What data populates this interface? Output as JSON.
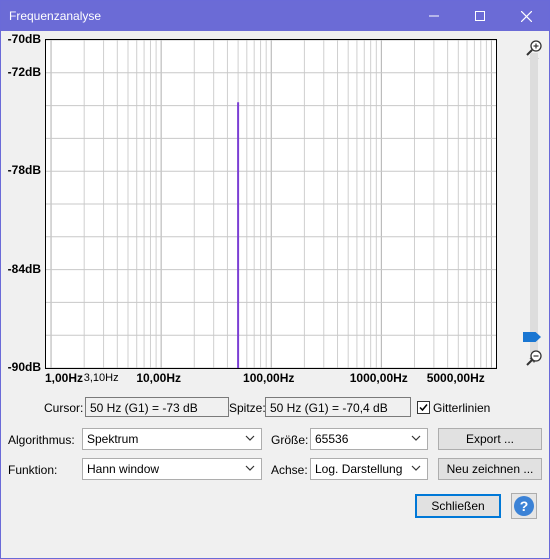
{
  "window": {
    "title": "Frequenzanalyse"
  },
  "chart_data": {
    "type": "line",
    "yticks": [
      "-70dB",
      "-72dB",
      "-78dB",
      "-84dB",
      "-90dB"
    ],
    "xticks": [
      "1,00Hz",
      "3,10Hz",
      "10,00Hz",
      "100,00Hz",
      "1000,00Hz",
      "5000,00Hz"
    ],
    "x_scale": "log",
    "ylim": [
      -90,
      -70
    ],
    "xlim": [
      0.9,
      11000
    ],
    "grid": true,
    "series": [
      {
        "x": [
          50,
          50
        ],
        "y": [
          -90,
          -73.8
        ]
      }
    ]
  },
  "status": {
    "cursor_label": "Cursor:",
    "cursor_value": "50 Hz (G1) = -73 dB",
    "peak_label": "Spitze:",
    "peak_value": "50 Hz (G1) = -70,4 dB",
    "gridlines_label": "Gitterlinien",
    "gridlines_checked": true
  },
  "controls": {
    "algorithm_label": "Algorithmus:",
    "algorithm_value": "Spektrum",
    "size_label": "Größe:",
    "size_value": "65536",
    "export_button": "Export ...",
    "function_label": "Funktion:",
    "function_value": "Hann window",
    "axis_label": "Achse:",
    "axis_value": "Log. Darstellung",
    "redraw_button": "Neu zeichnen ...",
    "close_button": "Schließen"
  },
  "colors": {
    "titlebar": "#6b6bd6",
    "spectrum": "#7b3fd4",
    "accent": "#0078d7"
  }
}
